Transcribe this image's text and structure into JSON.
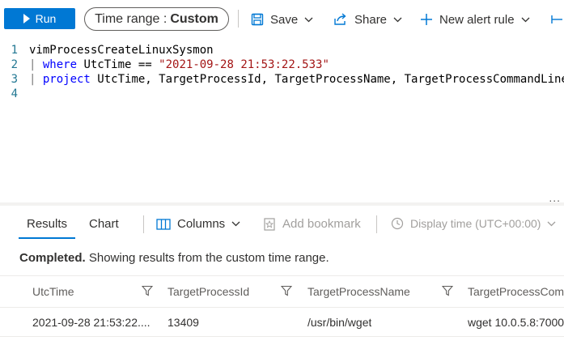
{
  "toolbar": {
    "run_label": "Run",
    "time_range_label": "Time range :",
    "time_range_value": "Custom",
    "save_label": "Save",
    "share_label": "Share",
    "new_alert_label": "New alert rule"
  },
  "editor": {
    "lines": [
      {
        "num": "1",
        "text": "vimProcessCreateLinuxSysmon"
      },
      {
        "num": "2",
        "pipe": "| ",
        "keyword": "where",
        "text": " UtcTime == ",
        "string": "\"2021-09-28 21:53:22.533\""
      },
      {
        "num": "3",
        "pipe": "| ",
        "keyword": "project",
        "text": " UtcTime, TargetProcessId, TargetProcessName, TargetProcessCommandLine"
      },
      {
        "num": "4",
        "text": ""
      }
    ],
    "more": "..."
  },
  "results": {
    "tabs": [
      "Results",
      "Chart"
    ],
    "columns_label": "Columns",
    "bookmark_label": "Add bookmark",
    "display_time_label": "Display time (UTC+00:00)",
    "status_bold": "Completed.",
    "status_text": " Showing results from the custom time range.",
    "headers": [
      "UtcTime",
      "TargetProcessId",
      "TargetProcessName",
      "TargetProcessCommandLine"
    ],
    "rows": [
      [
        "2021-09-28 21:53:22....",
        "13409",
        "/usr/bin/wget",
        "wget 10.0.5.8:7000"
      ]
    ]
  },
  "colors": {
    "accent": "#0078d4",
    "keyword": "#0000ff",
    "string": "#a31515",
    "line_number": "#237893"
  },
  "icons": [
    "play-icon",
    "save-icon",
    "share-icon",
    "plus-icon",
    "chevron-down-icon",
    "columns-icon",
    "bookmark-icon",
    "clock-icon",
    "filter-icon"
  ]
}
